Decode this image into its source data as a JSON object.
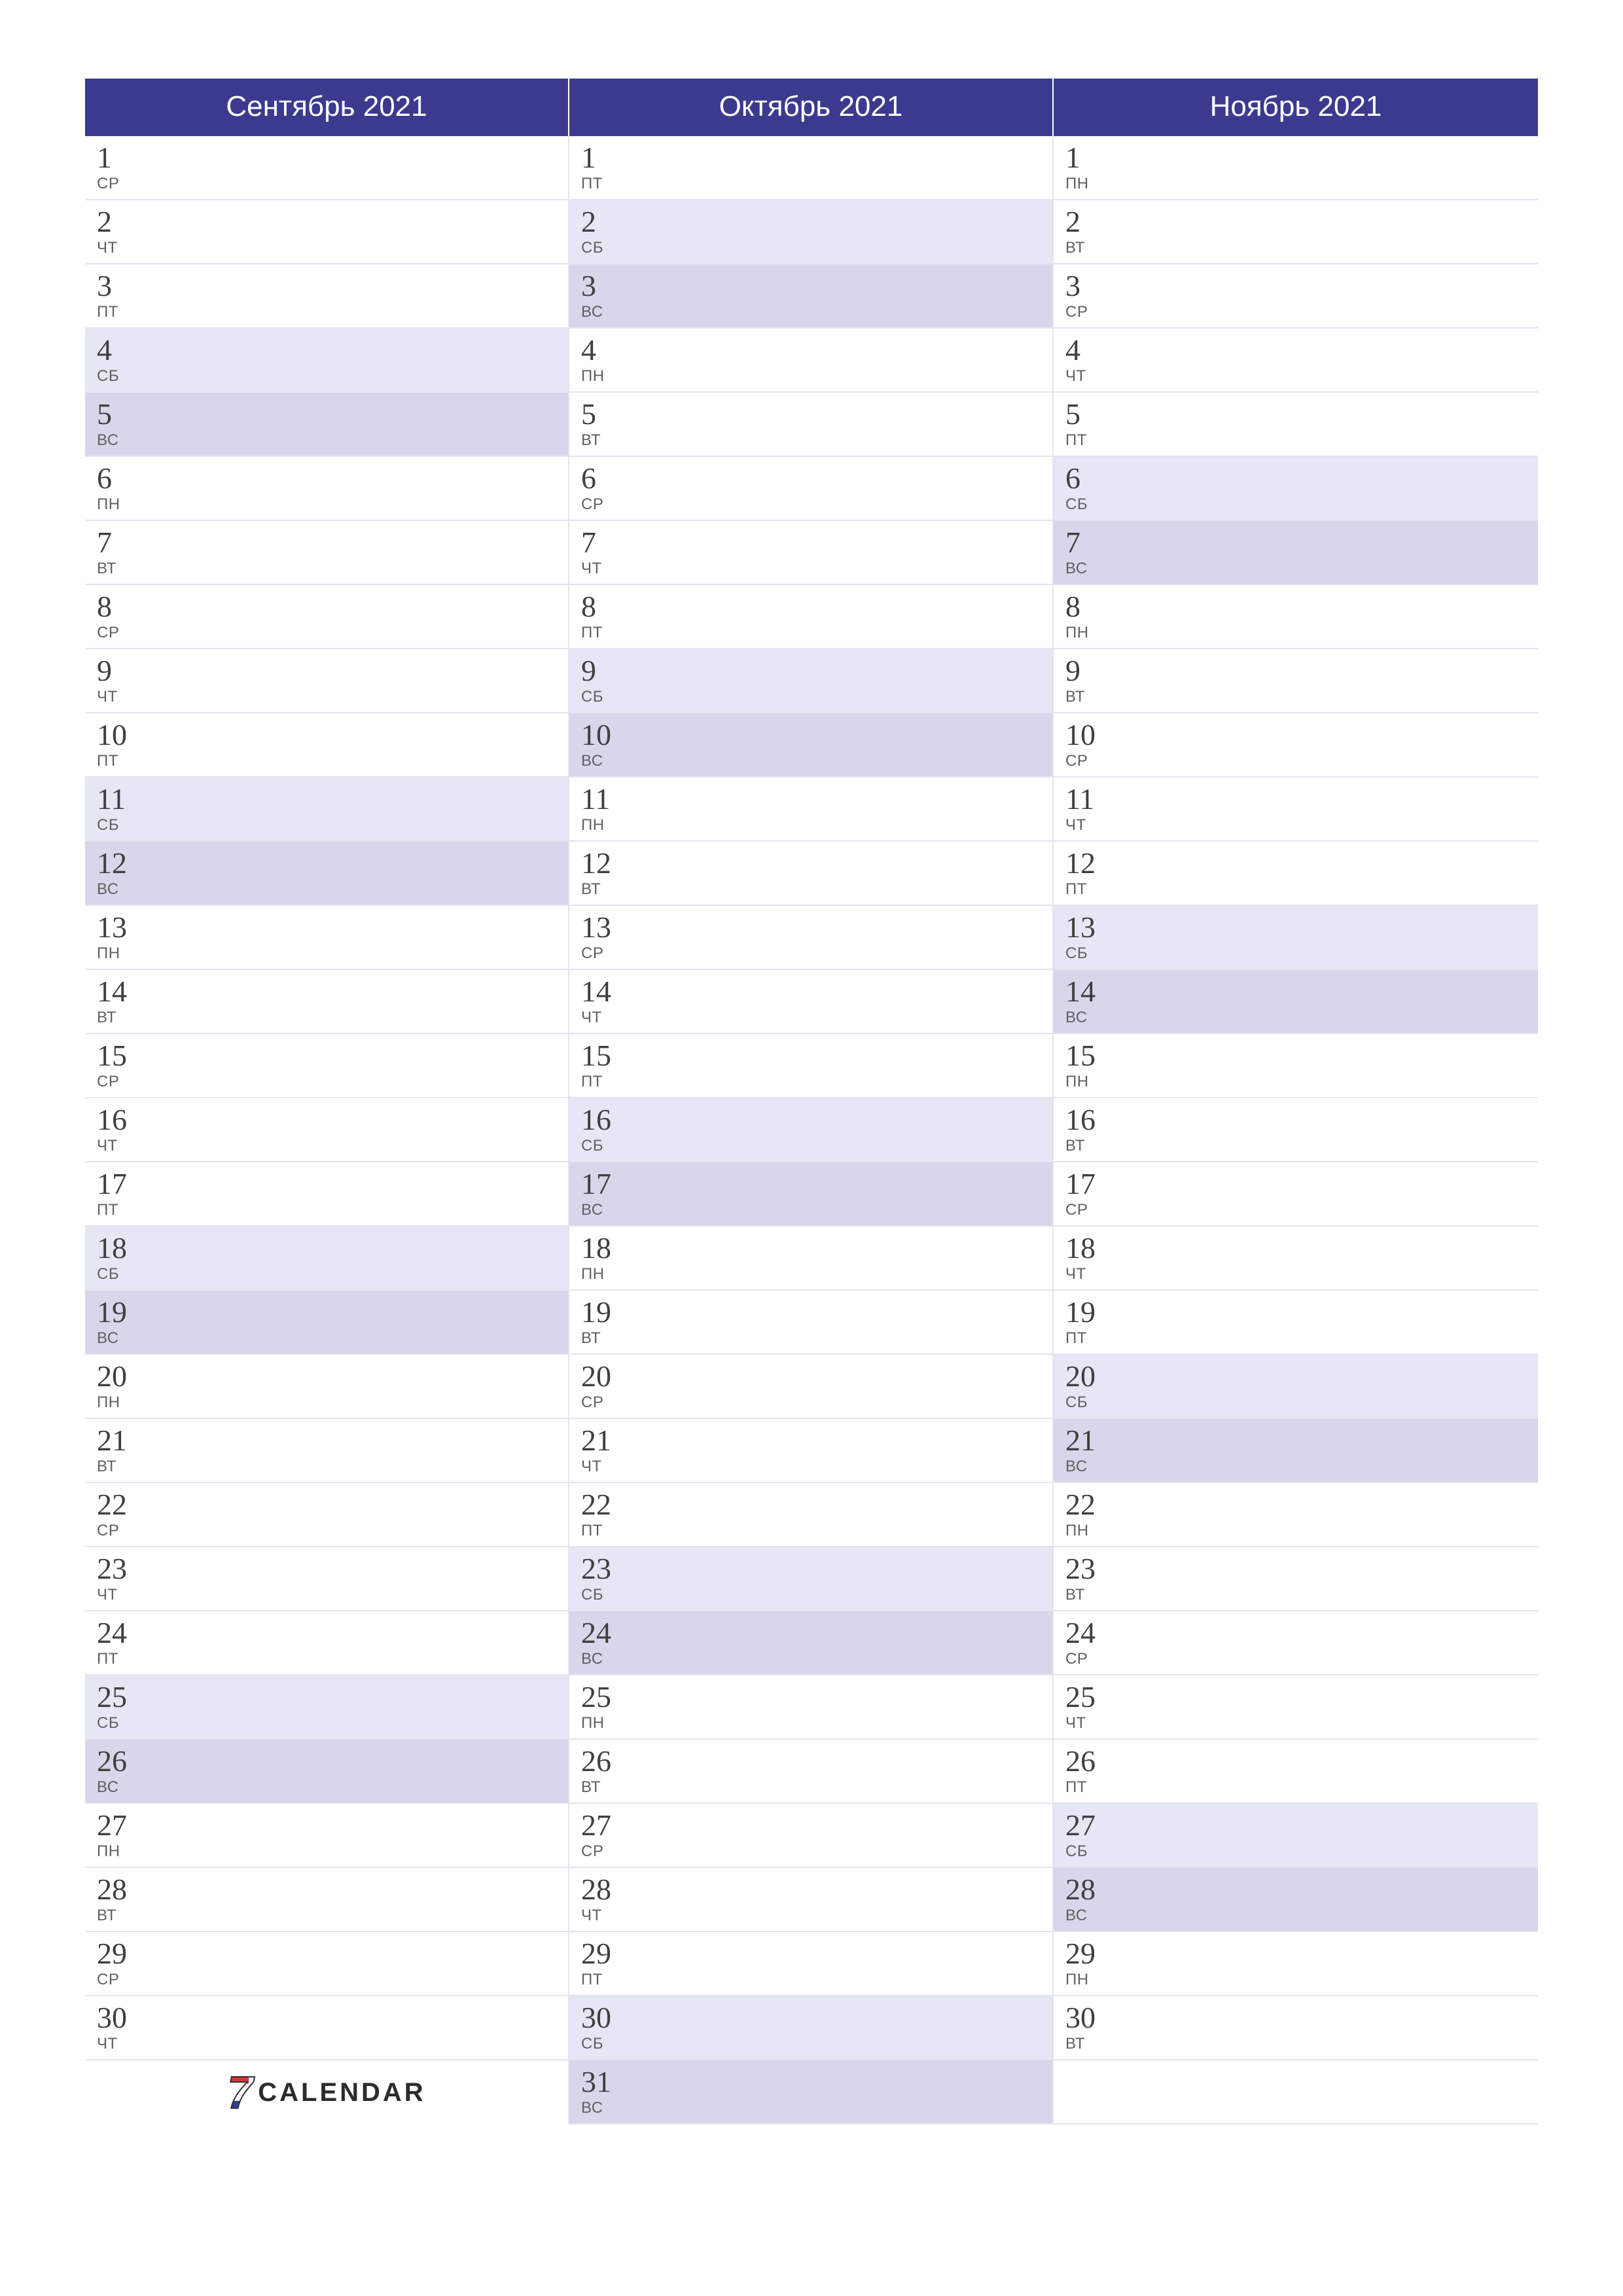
{
  "dow_labels": [
    "ПН",
    "ВТ",
    "СР",
    "ЧТ",
    "ПТ",
    "СБ",
    "ВС"
  ],
  "logo": {
    "mark": "7",
    "text": "CALENDAR"
  },
  "max_rows": 31,
  "months": [
    {
      "title": "Сентябрь 2021",
      "days_in_month": 30,
      "start_dow_index": 2
    },
    {
      "title": "Октябрь 2021",
      "days_in_month": 31,
      "start_dow_index": 4
    },
    {
      "title": "Ноябрь 2021",
      "days_in_month": 30,
      "start_dow_index": 0
    }
  ]
}
